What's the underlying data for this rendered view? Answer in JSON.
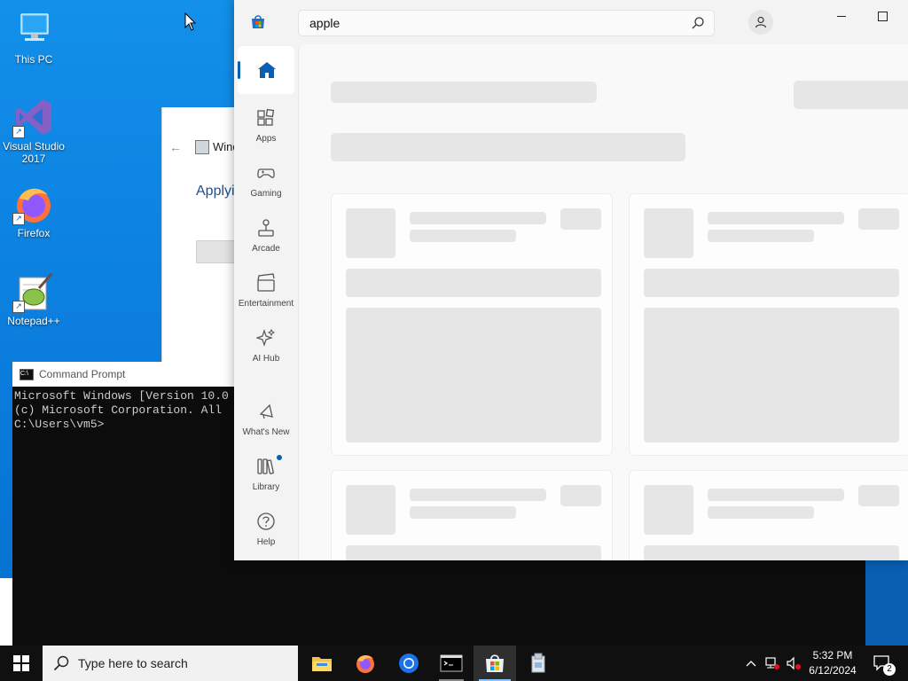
{
  "desktop": {
    "icons": [
      {
        "label": "This PC"
      },
      {
        "label": "Visual Studio 2017"
      },
      {
        "label": "Firefox"
      },
      {
        "label": "Notepad++"
      }
    ]
  },
  "background_window": {
    "title": "Wind",
    "heading": "Applyi"
  },
  "cmd": {
    "title": "Command Prompt",
    "lines": [
      "Microsoft Windows [Version 10.0",
      "(c) Microsoft Corporation. All",
      "",
      "C:\\Users\\vm5>"
    ]
  },
  "store": {
    "search_value": "apple",
    "nav": [
      {
        "label": "Apps"
      },
      {
        "label": "Gaming"
      },
      {
        "label": "Arcade"
      },
      {
        "label": "Entertainment"
      },
      {
        "label": "AI Hub"
      },
      {
        "label": "What's New"
      },
      {
        "label": "Library"
      },
      {
        "label": "Help"
      }
    ]
  },
  "taskbar": {
    "search_placeholder": "Type here to search",
    "time": "5:32 PM",
    "date": "6/12/2024",
    "notification_count": "2"
  },
  "colors": {
    "accent": "#0a5fb3",
    "desktop": "#0a78d7",
    "skeleton": "#e6e6e6"
  }
}
